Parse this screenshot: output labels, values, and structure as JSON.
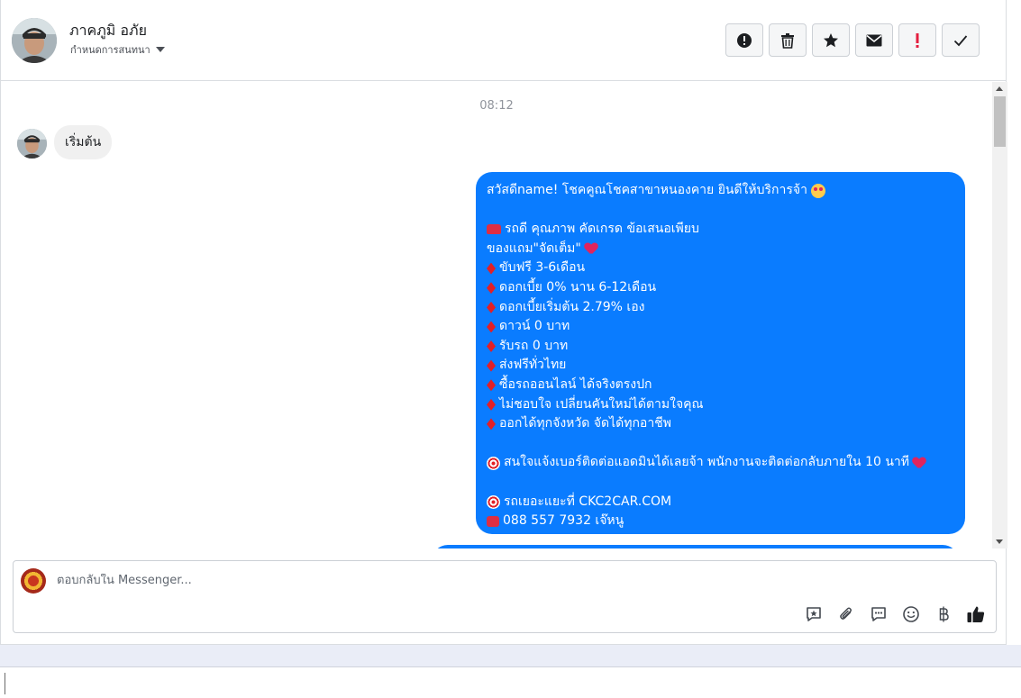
{
  "header": {
    "contact_name": "ภาคภูมิ อภัย",
    "assign_label": "กำหนดการสนทนา",
    "actions": [
      "mark-spam",
      "delete",
      "star",
      "mark-unread",
      "follow-up",
      "done"
    ]
  },
  "messages": {
    "timestamp": "08:12",
    "incoming_text": "เริ่มต้น",
    "outgoing_lines": [
      "สวัสดีname! โชคคูณโชคสาขาหนองคาย ยินดีให้บริการจ้า",
      "",
      "รถดี คุณภาพ คัดเกรด ข้อเสนอเพียบ",
      "ของแถม\"จัดเต็ม\"",
      " ขับฟรี 3-6เดือน",
      " ดอกเบี้ย 0% นาน 6-12เดือน",
      "ดอกเบี้ยเริ่มต้น 2.79% เอง",
      "ดาวน์ 0 บาท",
      "รับรถ 0 บาท",
      "ส่งฟรีทั่วไทย",
      "ซื้อรถออนไลน์ ได้จริงตรงปก",
      " ไม่ชอบใจ เปลี่ยนคันใหม่ได้ตามใจคุณ",
      " ออกได้ทุกจังหวัด จัดได้ทุกอาชีพ",
      "",
      "สนใจแจ้งเบอร์ติดต่อแอดมินได้เลยจ้า พนักงานจะติดต่อกลับภายใน 10 นาที",
      "",
      "รถเยอะแยะที่ CKC2CAR.COM",
      " 088 557 7932 เจ๊หนู"
    ]
  },
  "composer": {
    "placeholder": "ตอบกลับใน Messenger..."
  },
  "colors": {
    "outgoing_bubble": "#0a7cff",
    "incoming_bubble": "#f0f0f0",
    "follow_up_red": "#e41e3f"
  }
}
